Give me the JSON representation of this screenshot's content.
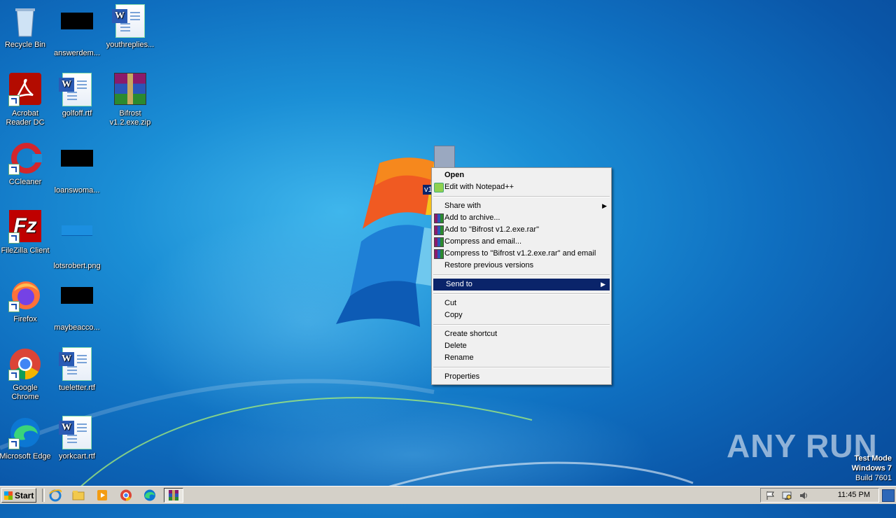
{
  "desktop": {
    "icons": [
      {
        "label": "Recycle Bin"
      },
      {
        "label": "answerdem..."
      },
      {
        "label": "youthreplies..."
      },
      {
        "label": "Acrobat Reader DC"
      },
      {
        "label": "golfoff.rtf"
      },
      {
        "label": "Bifrost v1.2.exe.zip"
      },
      {
        "label": "CCleaner"
      },
      {
        "label": "loanswoma..."
      },
      {
        "label": "FileZilla Client"
      },
      {
        "label": "lotsrobert.png"
      },
      {
        "label": "Firefox"
      },
      {
        "label": "maybeacco..."
      },
      {
        "label": "Google Chrome"
      },
      {
        "label": "tueletter.rtf"
      },
      {
        "label": "Microsoft Edge"
      },
      {
        "label": "yorkcart.rtf"
      }
    ],
    "selected_file": {
      "label": "v1"
    }
  },
  "context_menu": {
    "items": [
      {
        "label": "Open"
      },
      {
        "label": "Edit with Notepad++"
      },
      {
        "label": "Share with"
      },
      {
        "label": "Add to archive..."
      },
      {
        "label": "Add to \"Bifrost v1.2.exe.rar\""
      },
      {
        "label": "Compress and email..."
      },
      {
        "label": "Compress to \"Bifrost v1.2.exe.rar\" and email"
      },
      {
        "label": "Restore previous versions"
      },
      {
        "label": "Send to"
      },
      {
        "label": "Cut"
      },
      {
        "label": "Copy"
      },
      {
        "label": "Create shortcut"
      },
      {
        "label": "Delete"
      },
      {
        "label": "Rename"
      },
      {
        "label": "Properties"
      }
    ]
  },
  "watermark": {
    "text": "ANY RUN"
  },
  "system_info": {
    "line1": "Test Mode",
    "line2": "Windows 7",
    "line3": "Build 7601"
  },
  "taskbar": {
    "start_label": "Start",
    "clock": "11:45 PM"
  }
}
